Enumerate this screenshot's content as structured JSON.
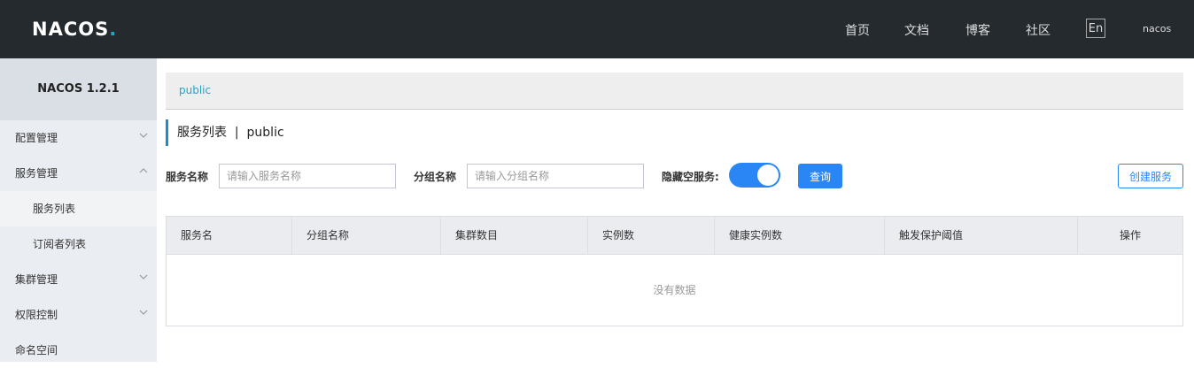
{
  "topbar": {
    "logo": {
      "text": "NACOS",
      "dot": "."
    },
    "nav": [
      "首页",
      "文档",
      "博客",
      "社区"
    ],
    "lang": "En",
    "user": "nacos"
  },
  "sidebar": {
    "title": "NACOS 1.2.1",
    "items": [
      {
        "label": "配置管理",
        "icon": "chevron-down-icon"
      },
      {
        "label": "服务管理",
        "icon": "chevron-up-icon"
      },
      {
        "label": "服务列表"
      },
      {
        "label": "订阅者列表"
      },
      {
        "label": "集群管理",
        "icon": "chevron-down-icon"
      },
      {
        "label": "权限控制",
        "icon": "chevron-down-icon"
      },
      {
        "label": "命名空间"
      }
    ]
  },
  "breadcrumb": "public",
  "page": {
    "title": "服务列表",
    "separator": "|",
    "namespace": "public"
  },
  "filters": {
    "service_name_label": "服务名称",
    "service_name_placeholder": "请输入服务名称",
    "group_name_label": "分组名称",
    "group_name_placeholder": "请输入分组名称",
    "hide_empty_label": "隐藏空服务:",
    "hide_empty_on": true,
    "query_button": "查询",
    "create_button": "创建服务"
  },
  "table": {
    "columns": [
      "服务名",
      "分组名称",
      "集群数目",
      "实例数",
      "健康实例数",
      "触发保护阈值",
      "操作"
    ],
    "empty_text": "没有数据"
  },
  "colors": {
    "accent": "#2b86f5",
    "topbar": "#252a2f",
    "sidebar": "#eaedf1",
    "breadcrumb_link": "#1ea7c7"
  }
}
